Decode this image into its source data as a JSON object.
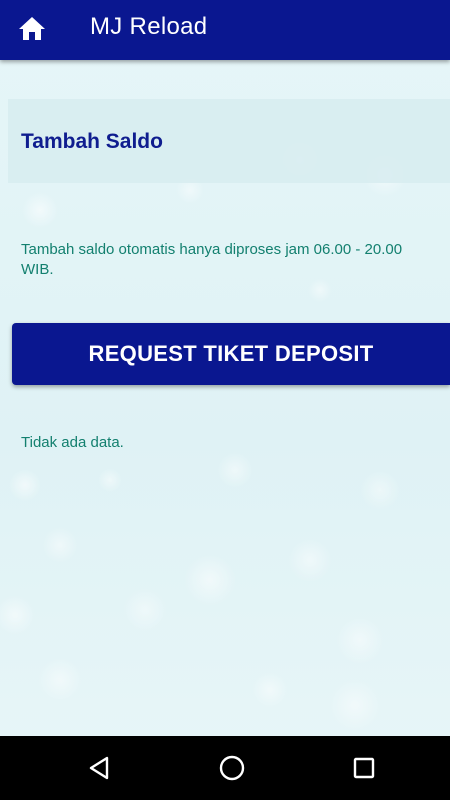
{
  "app": {
    "title": "MJ Reload",
    "home_icon": "home-icon",
    "bar_color": "#0a1790"
  },
  "section": {
    "title": "Tambah Saldo"
  },
  "info": {
    "text": "Tambah saldo otomatis hanya diproses jam 06.00 - 20.00 WIB."
  },
  "actions": {
    "request_label": "REQUEST TIKET DEPOSIT"
  },
  "list": {
    "empty_text": "Tidak ada data."
  },
  "navbar": {
    "icons": [
      "back-triangle-icon",
      "home-circle-icon",
      "recents-square-icon"
    ]
  },
  "colors": {
    "primary": "#0a1790",
    "text_teal": "#13806f",
    "title_blue": "#0f1d8f"
  }
}
